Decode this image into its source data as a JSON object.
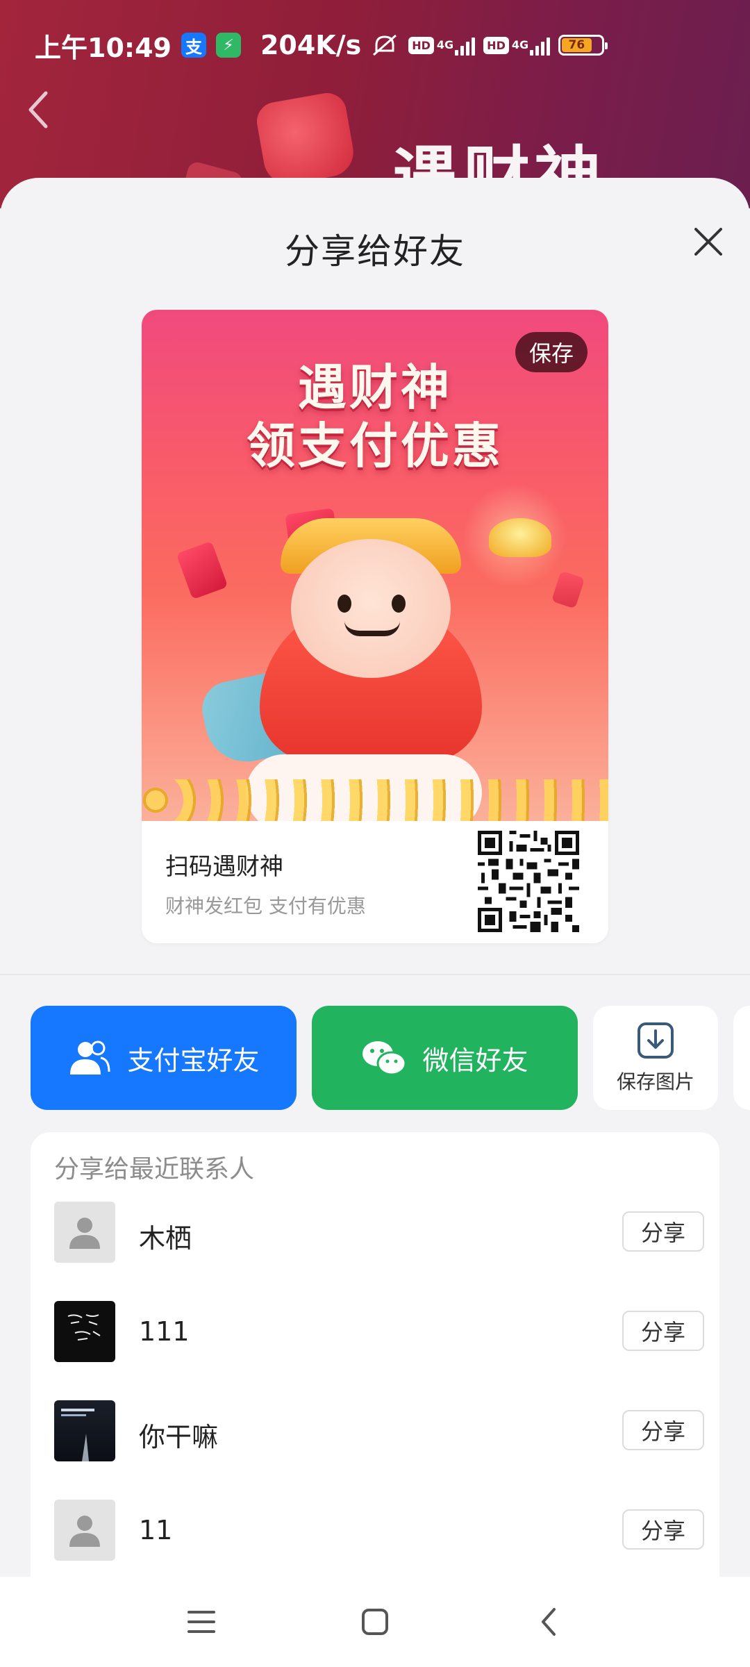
{
  "status_bar": {
    "time": "上午10:49",
    "net_speed": "204K/s",
    "battery": "76",
    "battery_level": 0.76,
    "app1_glyph": "支",
    "app2_glyph": "⚡",
    "hd": "HD",
    "net": "4G",
    "icons": [
      "alipay-icon",
      "charging-app-icon",
      "mute-icon",
      "hd-icon",
      "signal-icon",
      "battery-icon"
    ]
  },
  "background_page": {
    "title": "遇财神",
    "back_icon": "chevron-left-icon"
  },
  "sheet": {
    "title": "分享给好友",
    "close_icon": "close-icon"
  },
  "poster": {
    "save_badge": "保存",
    "headline_line1": "遇财神",
    "headline_line2": "领支付优惠",
    "caption_title": "扫码遇财神",
    "caption_subtitle": "财神发红包 支付有优惠",
    "qr_icon": "qr-code-icon"
  },
  "actions": {
    "alipay_label": "支付宝好友",
    "wechat_label": "微信好友",
    "save_image_label": "保存图片",
    "colors": {
      "alipay": "#1677ff",
      "wechat": "#22b35e"
    }
  },
  "recent_contacts": {
    "title": "分享给最近联系人",
    "share_label": "分享",
    "items": [
      {
        "name": "木栖",
        "avatar": "default-avatar"
      },
      {
        "name": "111",
        "avatar": "calligraphy-avatar"
      },
      {
        "name": "你干嘛",
        "avatar": "photo-avatar"
      },
      {
        "name": "11",
        "avatar": "default-avatar"
      }
    ]
  },
  "nav_bar": {
    "icons": [
      "menu-icon",
      "home-icon",
      "back-icon"
    ]
  }
}
